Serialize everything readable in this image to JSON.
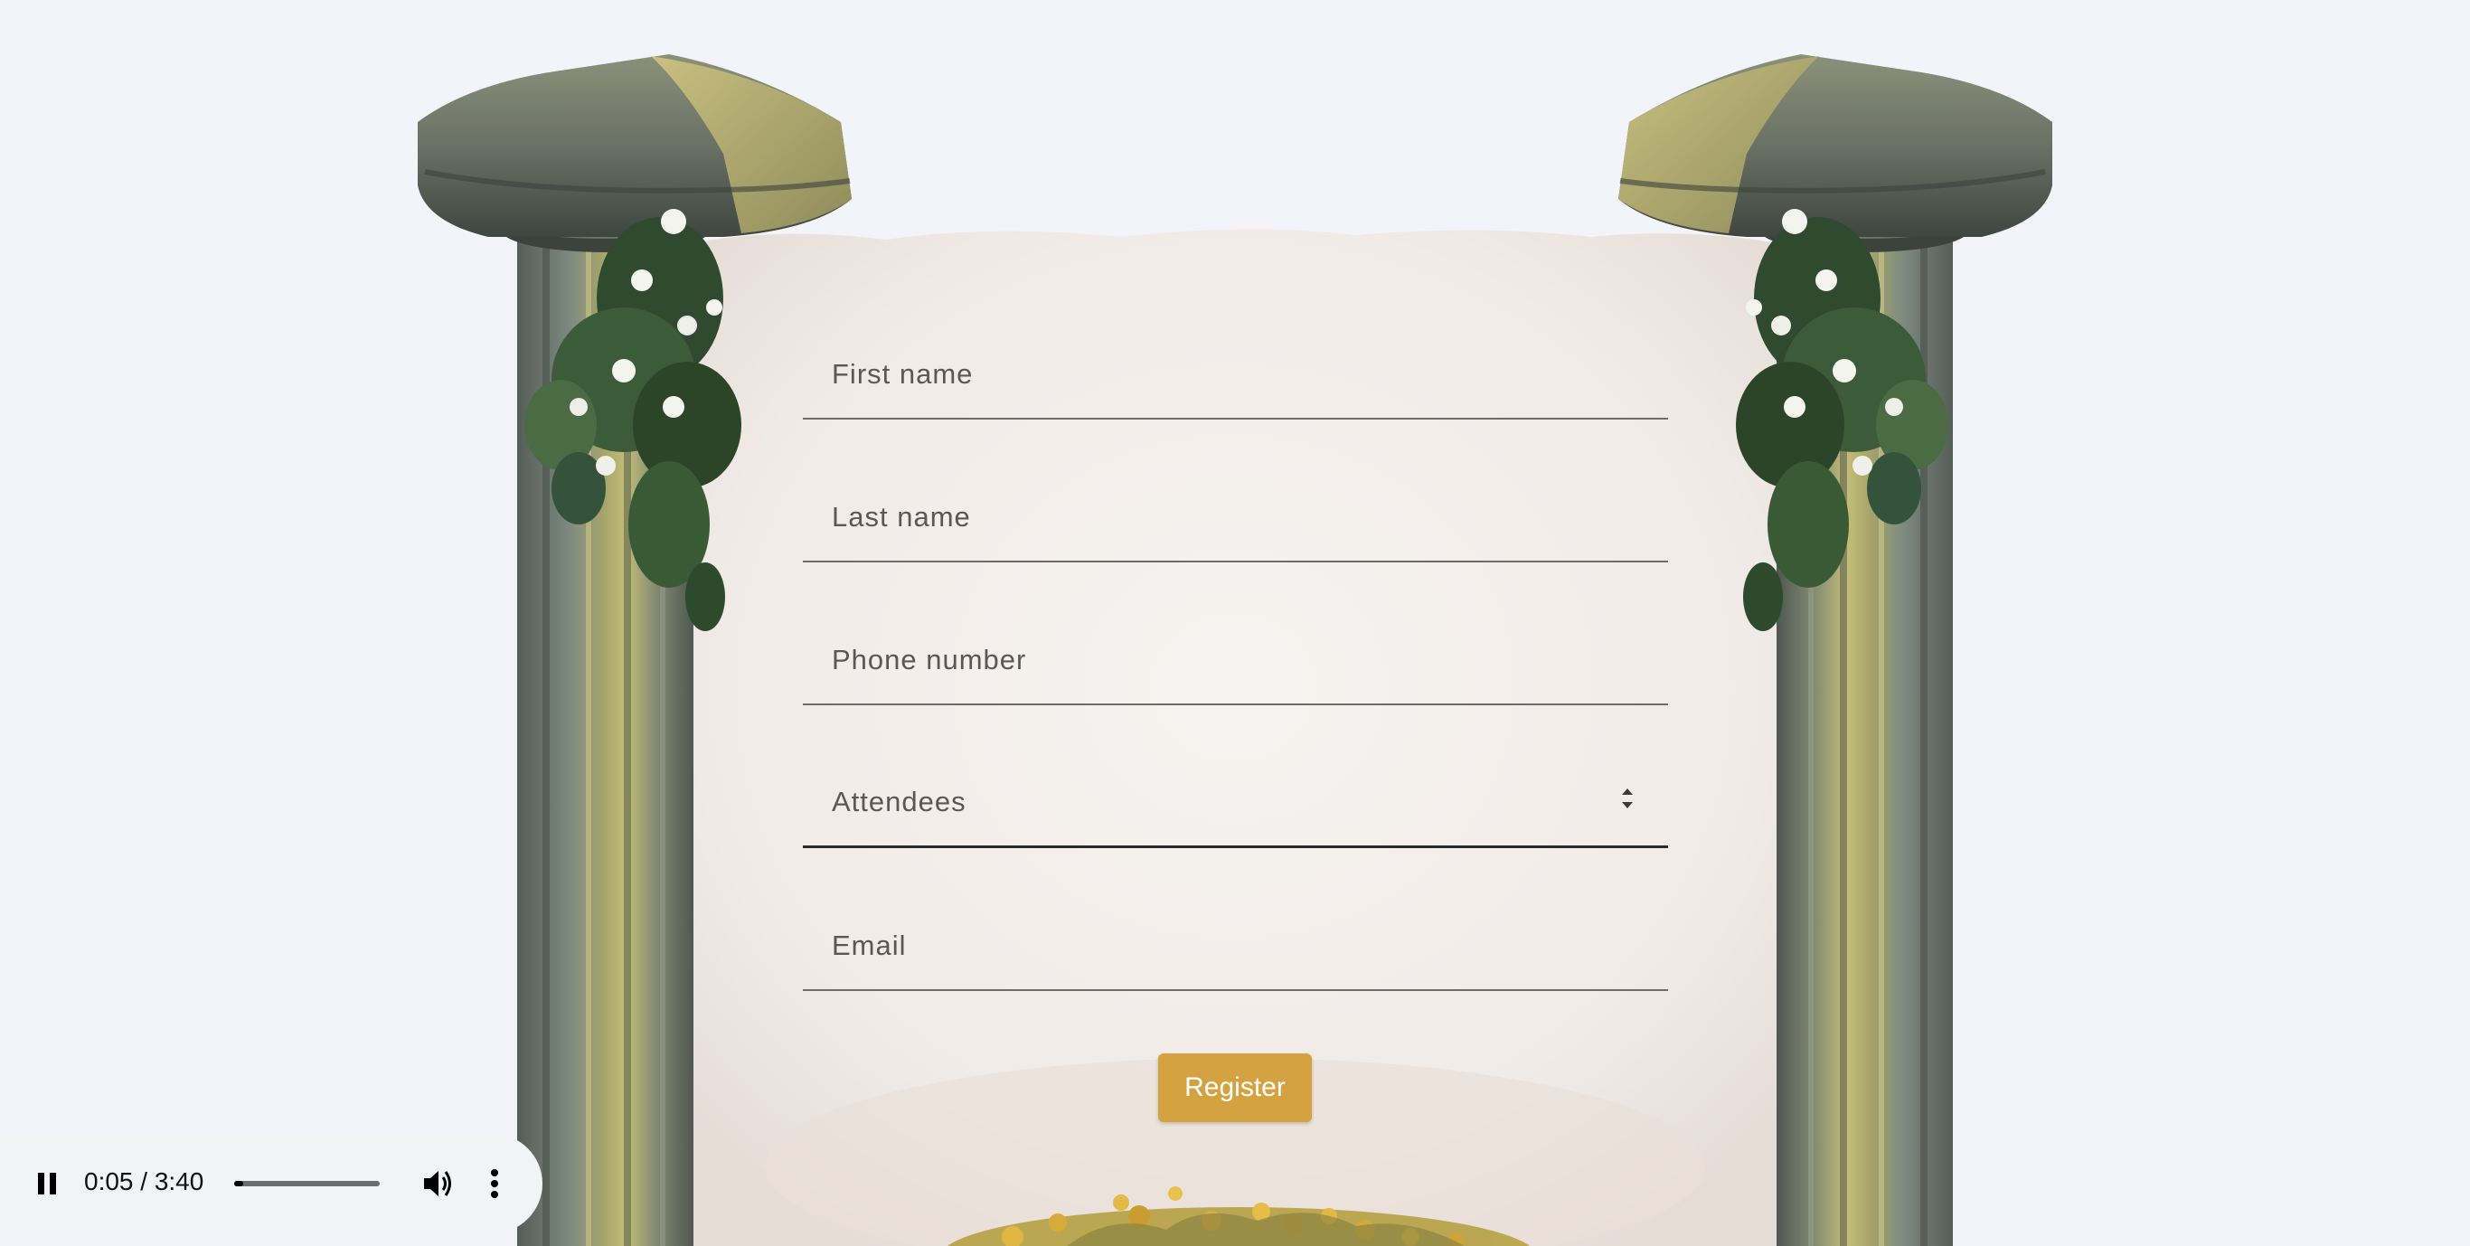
{
  "form": {
    "first_name_placeholder": "First name",
    "last_name_placeholder": "Last name",
    "phone_placeholder": "Phone number",
    "attendees_placeholder": "Attendees",
    "email_placeholder": "Email",
    "register_label": "Register"
  },
  "player": {
    "time": "0:05 / 3:40",
    "progress_fraction": 0.023,
    "state": "playing"
  },
  "icons": {
    "play_state": "pause-icon",
    "volume": "volume-icon",
    "menu": "more-vert-icon"
  },
  "colors": {
    "background": "#f3f4f9",
    "accent": "#d4a241",
    "parchment": "#f3efec"
  }
}
